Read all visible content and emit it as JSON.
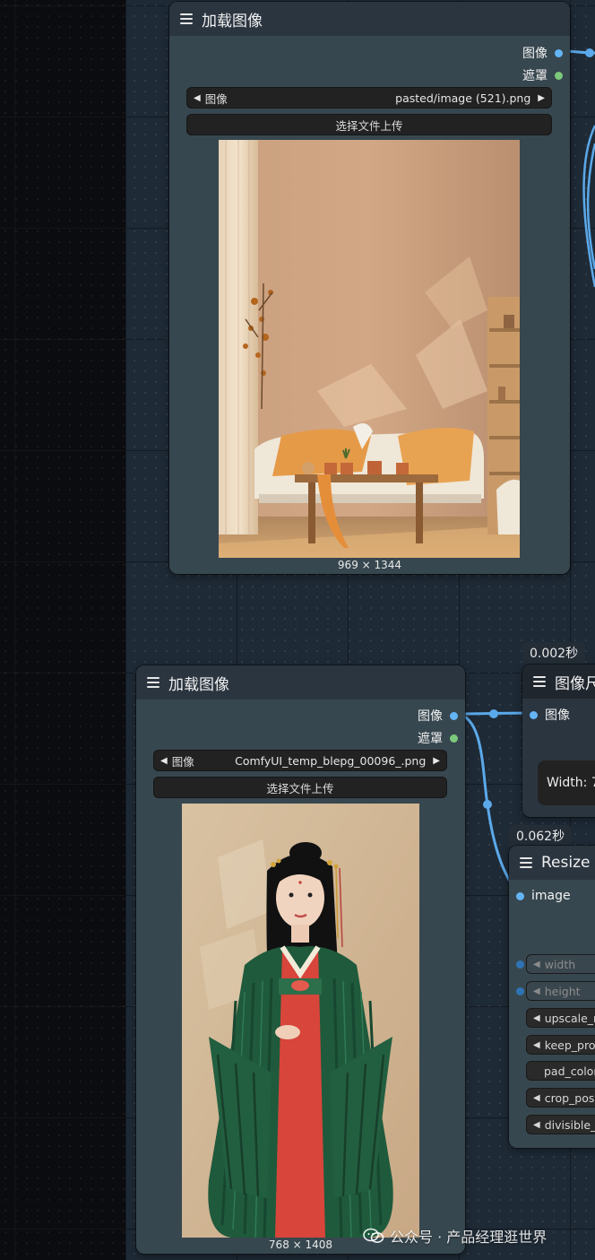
{
  "node_top": {
    "title": "加载图像",
    "outputs": [
      "图像",
      "遮罩"
    ],
    "combo_label": "图像",
    "combo_value": "pasted/image (521).png",
    "upload_label": "选择文件上传",
    "dims": "969 × 1344"
  },
  "node_bottom": {
    "title": "加载图像",
    "outputs": [
      "图像",
      "遮罩"
    ],
    "combo_label": "图像",
    "combo_value": "ComfyUI_temp_blepg_00096_.png",
    "upload_label": "选择文件上传",
    "dims": "768 × 1408"
  },
  "node_size": {
    "timing": "0.002秒",
    "title": "图像尺",
    "input": "图像",
    "width_text": "Width: 7"
  },
  "node_resize": {
    "timing": "0.062秒",
    "title": "Resize",
    "input": "image",
    "widgets": [
      "width",
      "height",
      "upscale_r",
      "keep_prop",
      "pad_color",
      "crop_posi",
      "divisible_"
    ]
  },
  "watermark": "公众号 · 产品经理逛世界",
  "colors": {
    "canvas": "#1e2a36",
    "node_body": "#37474f",
    "node_header": "#2b3540",
    "link_blue": "#5ba9ea",
    "slot_green": "#7cc97c"
  },
  "icons": {
    "node_menu": "hamburger-icon",
    "combo_left": "triangle-left-icon",
    "combo_right": "triangle-right-icon",
    "watermark": "wechat-icon"
  }
}
